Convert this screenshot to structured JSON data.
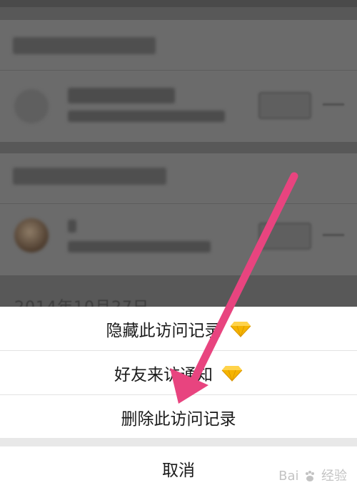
{
  "background": {
    "partial_date_text": "2014年10月27日"
  },
  "action_sheet": {
    "items": [
      {
        "label": "隐藏此访问记录",
        "icon": "diamond-icon"
      },
      {
        "label": "好友来访通知",
        "icon": "diamond-icon"
      },
      {
        "label": "删除此访问记录",
        "icon": null
      }
    ],
    "cancel_label": "取消"
  },
  "annotation": {
    "arrow_color": "#e8447f"
  },
  "watermark": {
    "text_left": "Bai",
    "text_right": "经验"
  },
  "colors": {
    "dim_overlay": "#585858",
    "sheet_bg": "#ffffff",
    "diamond_gold": "#f5b400"
  }
}
